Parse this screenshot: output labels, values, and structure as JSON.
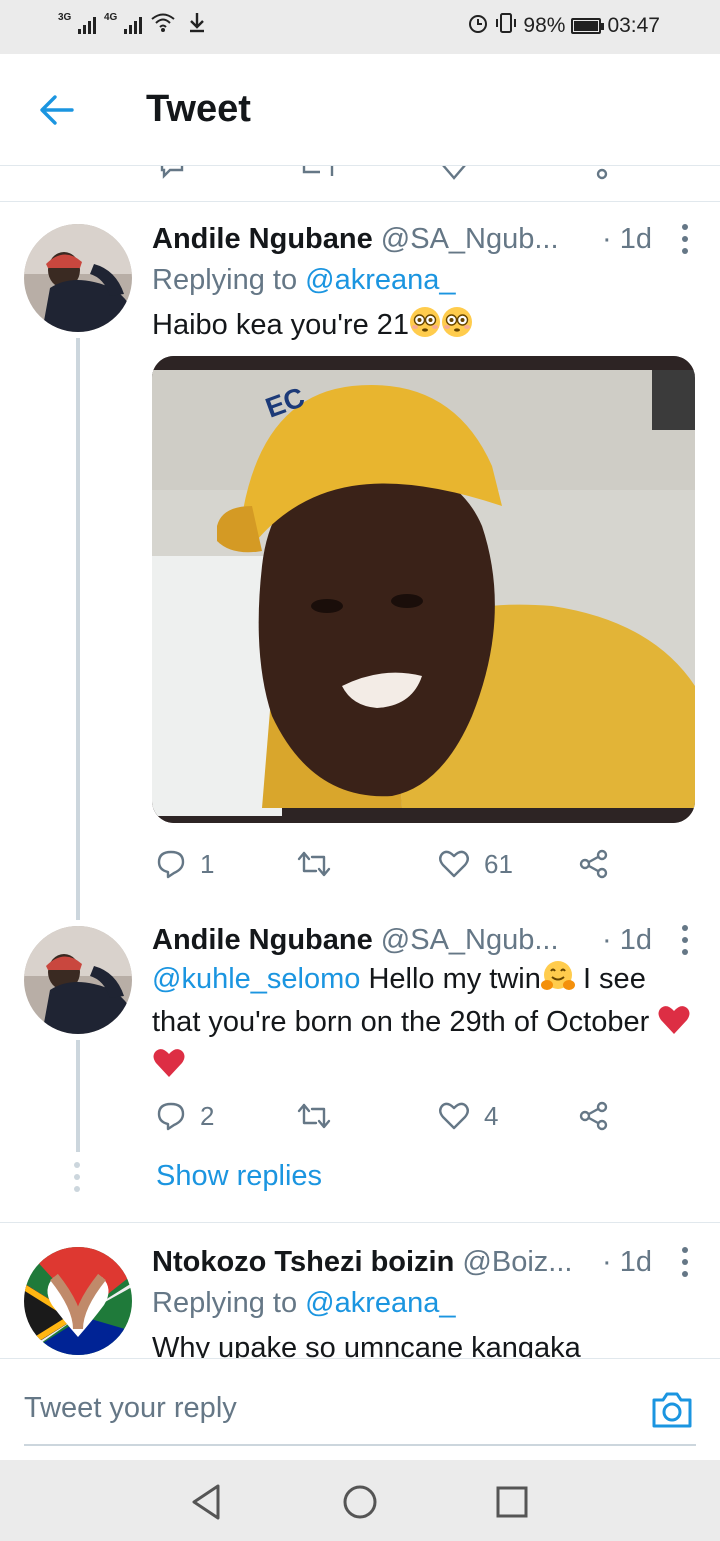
{
  "status_bar": {
    "network_1": "3G",
    "network_2": "4G",
    "battery_text": "98%",
    "battery_level": 0.98,
    "time": "03:47"
  },
  "header": {
    "title": "Tweet"
  },
  "tweets": [
    {
      "name": "Andile Ngubane",
      "handle": "@SA_Ngub...",
      "time": "· 1d",
      "replying_prefix": "Replying to ",
      "replying_to": "@akreana_",
      "text": "Haibo kea you're 21",
      "emojis": [
        "flushed-face-emoji",
        "flushed-face-emoji"
      ],
      "has_media": true,
      "replies": "1",
      "retweets": "",
      "likes": "61"
    },
    {
      "name": "Andile Ngubane",
      "handle": "@SA_Ngub...",
      "time": "· 1d",
      "mention": "@kuhle_selomo",
      "text_a": " Hello my twin",
      "text_b": "  I see that you're born on the 29th of October ",
      "replies": "2",
      "retweets": "",
      "likes": "4",
      "show_replies": "Show replies"
    },
    {
      "name": "Ntokozo Tshezi boizin",
      "handle": "@Boiz...",
      "time": "· 1d",
      "replying_prefix": "Replying to ",
      "replying_to": "@akreana_",
      "text": "Why upake so umncane kangaka"
    }
  ],
  "compose": {
    "placeholder": "Tweet your reply"
  },
  "colors": {
    "accent": "#1b95e0",
    "text": "#14171a",
    "muted": "#657786",
    "divider": "#e1e8ed",
    "heart_red": "#dd2e44"
  }
}
